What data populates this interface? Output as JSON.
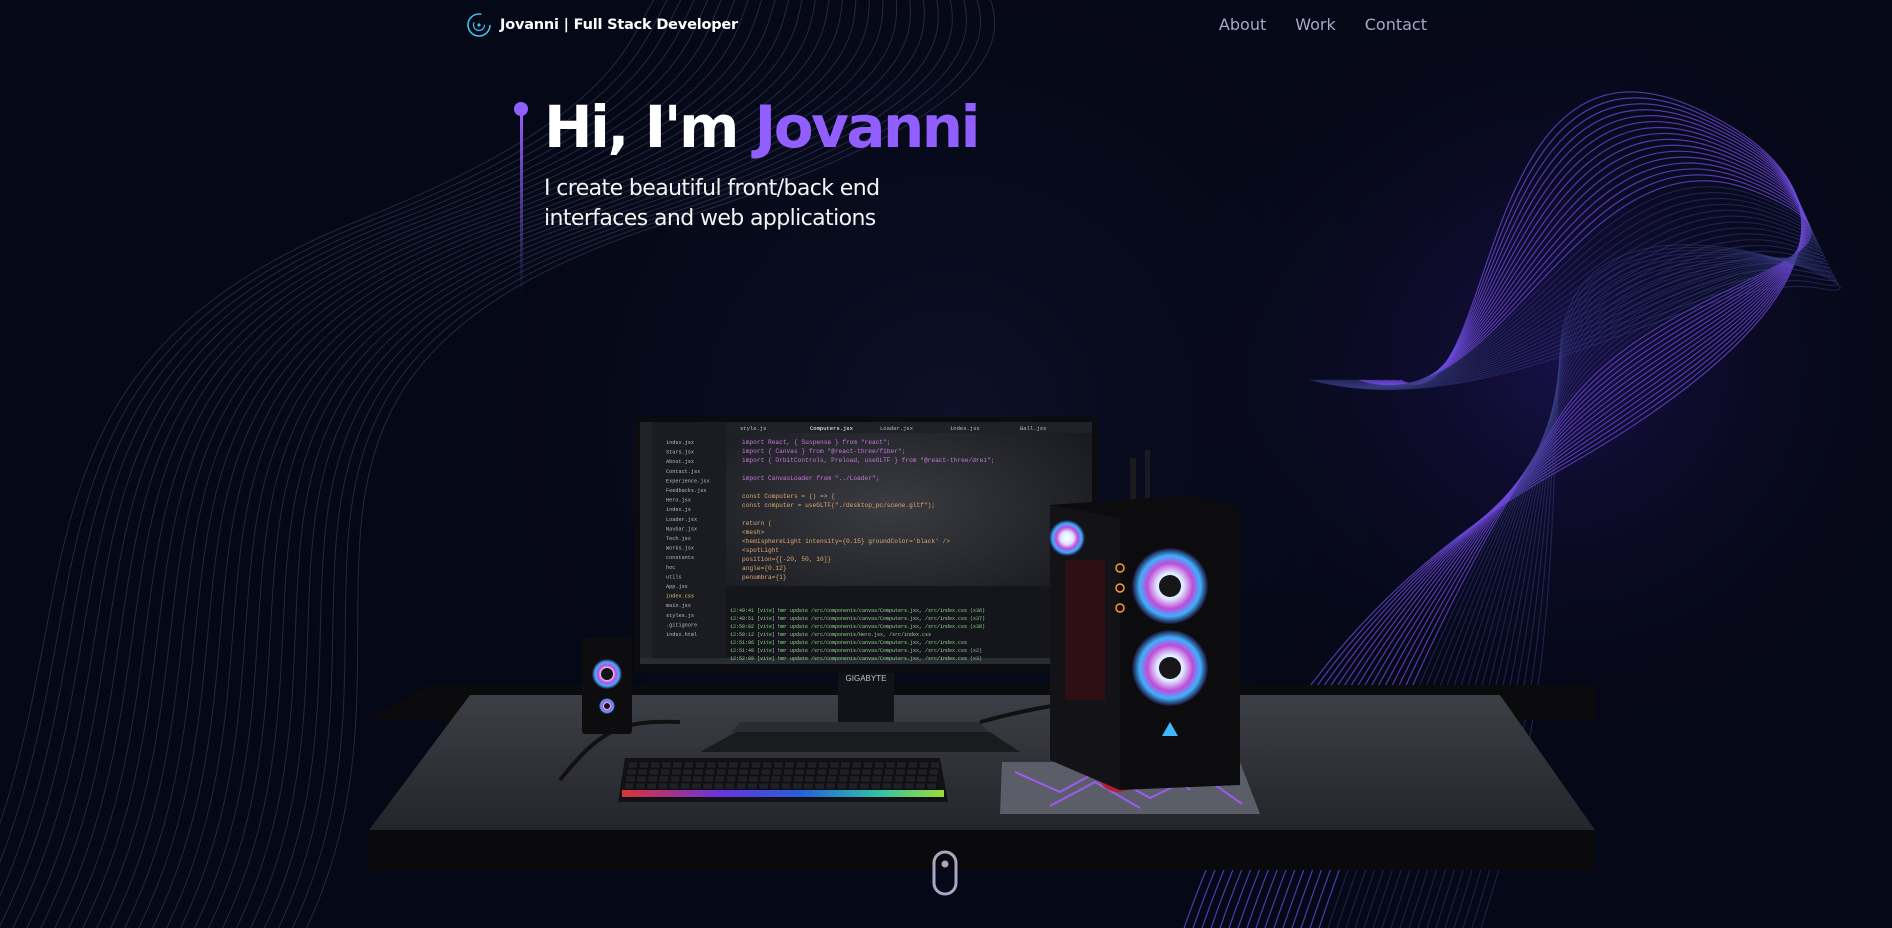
{
  "nav": {
    "brand_name": "Jovanni | Full Stack Developer",
    "links": [
      "About",
      "Work",
      "Contact"
    ]
  },
  "hero": {
    "greeting": "Hi, I'm ",
    "name": "Jovanni",
    "subtitle": "I create beautiful front/back end interfaces and web applications"
  },
  "scene": {
    "monitor_brand": "GIGABYTE",
    "code_lines": [
      "import React, { Suspense } from \"react\";",
      "import { Canvas } from \"@react-three/fiber\";",
      "import { OrbitControls, Preload, useGLTF } from \"@react-three/drei\";",
      "",
      "import CanvasLoader from \"../Loader\";",
      "",
      "const Computers = () => {",
      "  const computer = useGLTF(\"./desktop_pc/scene.gltf\");",
      "",
      "  return (",
      "    <mesh>",
      "      <hemisphereLight intensity={0.15} groundColor='black' />",
      "      <spotLight",
      "        position={[-20, 50, 10]}",
      "        angle={0.12}",
      "        penumbra={1}"
    ],
    "file_tree": [
      "index.jsx",
      "Stars.jsx",
      "About.jsx",
      "Contact.jsx",
      "Experience.jsx",
      "Feedbacks.jsx",
      "Hero.jsx",
      "index.js",
      "Loader.jsx",
      "Navbar.jsx",
      "Tech.jsx",
      "Works.jsx",
      "constants",
      "hoc",
      "utils",
      "App.jsx",
      "index.css",
      "main.jsx",
      "styles.js",
      ".gitignore",
      "index.html"
    ],
    "tabs": [
      "style.js",
      "Computers.jsx",
      "Loader.jsx",
      "index.jsx",
      "Ball.jsx"
    ],
    "terminal_lines": [
      "12:49:41 [vite] hmr update /src/components/canvas/Computers.jsx, /src/index.css (x36)",
      "12:49:51 [vite] hmr update /src/components/canvas/Computers.jsx, /src/index.css (x37)",
      "12:50:02 [vite] hmr update /src/components/canvas/Computers.jsx, /src/index.css (x38)",
      "12:50:12 [vite] hmr update /src/components/Hero.jsx, /src/index.css",
      "12:51:06 [vite] hmr update /src/components/canvas/Computers.jsx, /src/index.css",
      "12:51:48 [vite] hmr update /src/components/canvas/Computers.jsx, /src/index.css (x2)",
      "12:52:09 [vite] hmr update /src/components/canvas/Computers.jsx, /src/index.css (x3)"
    ]
  },
  "colors": {
    "background": "#050816",
    "accent": "#915eff",
    "nav_link": "#aaa6c3"
  },
  "icons": [
    "logo-icon",
    "scroll-mouse-icon"
  ]
}
